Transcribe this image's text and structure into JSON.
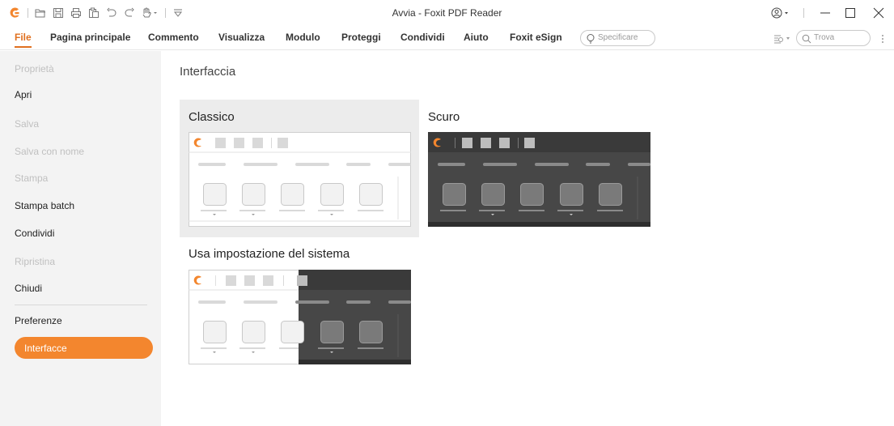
{
  "window": {
    "title": "Avvia - Foxit PDF Reader"
  },
  "quick_access": {
    "icons": [
      "open-icon",
      "save-icon",
      "print-icon",
      "paste-icon",
      "undo-icon",
      "redo-icon",
      "hand-tool-icon",
      "customize-icon"
    ]
  },
  "ribbon": {
    "tabs": [
      {
        "label": "File",
        "active": true
      },
      {
        "label": "Pagina principale",
        "active": false
      },
      {
        "label": "Commento",
        "active": false
      },
      {
        "label": "Visualizza",
        "active": false
      },
      {
        "label": "Modulo",
        "active": false
      },
      {
        "label": "Proteggi",
        "active": false
      },
      {
        "label": "Condividi",
        "active": false
      },
      {
        "label": "Aiuto",
        "active": false
      },
      {
        "label": "Foxit eSign",
        "active": false
      }
    ],
    "tell_me_placeholder": "Specificare",
    "find_placeholder": "Trova"
  },
  "sidebar": {
    "items": [
      {
        "label": "Proprietà",
        "enabled": false
      },
      {
        "label": "Apri",
        "enabled": true
      },
      {
        "label": "Salva",
        "enabled": false
      },
      {
        "label": "Salva con nome",
        "enabled": false
      },
      {
        "label": "Stampa",
        "enabled": false
      },
      {
        "label": "Stampa batch",
        "enabled": true
      },
      {
        "label": "Condividi",
        "enabled": true
      },
      {
        "label": "Ripristina",
        "enabled": false
      },
      {
        "label": "Chiudi",
        "enabled": true
      },
      {
        "label": "Preferenze",
        "enabled": true
      },
      {
        "label": "Interfacce",
        "enabled": true,
        "selected": true
      }
    ]
  },
  "main": {
    "title": "Interfaccia",
    "options": [
      {
        "label": "Classico",
        "selected": true
      },
      {
        "label": "Scuro",
        "selected": false
      },
      {
        "label": "Usa impostazione del sistema",
        "selected": false
      }
    ]
  },
  "colors": {
    "accent": "#f3862e",
    "brand": "#e0701f",
    "dark_theme": "#474747",
    "light_theme": "#ffffff"
  }
}
